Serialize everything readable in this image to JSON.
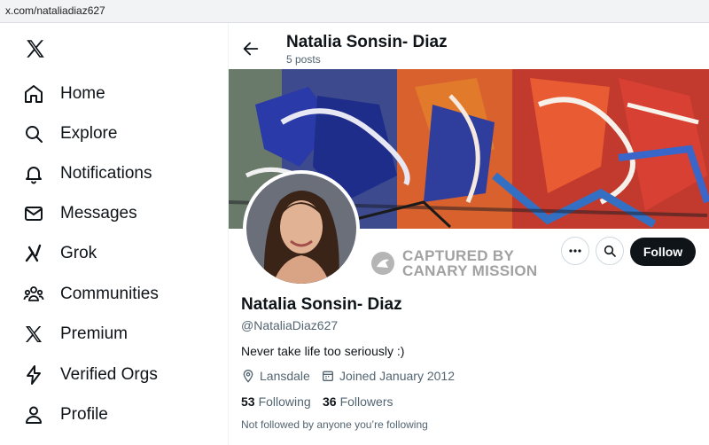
{
  "browser": {
    "url": "x.com/nataliadiaz627"
  },
  "sidebar": {
    "logo": "x-logo-icon",
    "items": [
      {
        "label": "Home",
        "icon": "home-icon"
      },
      {
        "label": "Explore",
        "icon": "search-icon"
      },
      {
        "label": "Notifications",
        "icon": "bell-icon"
      },
      {
        "label": "Messages",
        "icon": "mail-icon"
      },
      {
        "label": "Grok",
        "icon": "grok-icon"
      },
      {
        "label": "Communities",
        "icon": "people-icon"
      },
      {
        "label": "Premium",
        "icon": "x-logo-icon"
      },
      {
        "label": "Verified Orgs",
        "icon": "lightning-icon"
      },
      {
        "label": "Profile",
        "icon": "person-icon"
      }
    ]
  },
  "header": {
    "name": "Natalia Sonsin- Diaz",
    "posts": "5 posts"
  },
  "watermark": {
    "line1": "CAPTURED BY",
    "line2": "CANARY MISSION"
  },
  "actions": {
    "follow_label": "Follow"
  },
  "profile": {
    "name": "Natalia Sonsin- Diaz",
    "handle": "@NataliaDiaz627",
    "bio": "Never take life too seriously :)",
    "location": "Lansdale",
    "joined": "Joined January 2012",
    "following_count": "53",
    "following_label": "Following",
    "followers_count": "36",
    "followers_label": "Followers",
    "not_followed_note": "Not followed by anyone you’re following"
  },
  "colors": {
    "text": "#0f1419",
    "muted": "#536471",
    "follow_bg": "#0f1419",
    "border": "#cfd9de"
  }
}
